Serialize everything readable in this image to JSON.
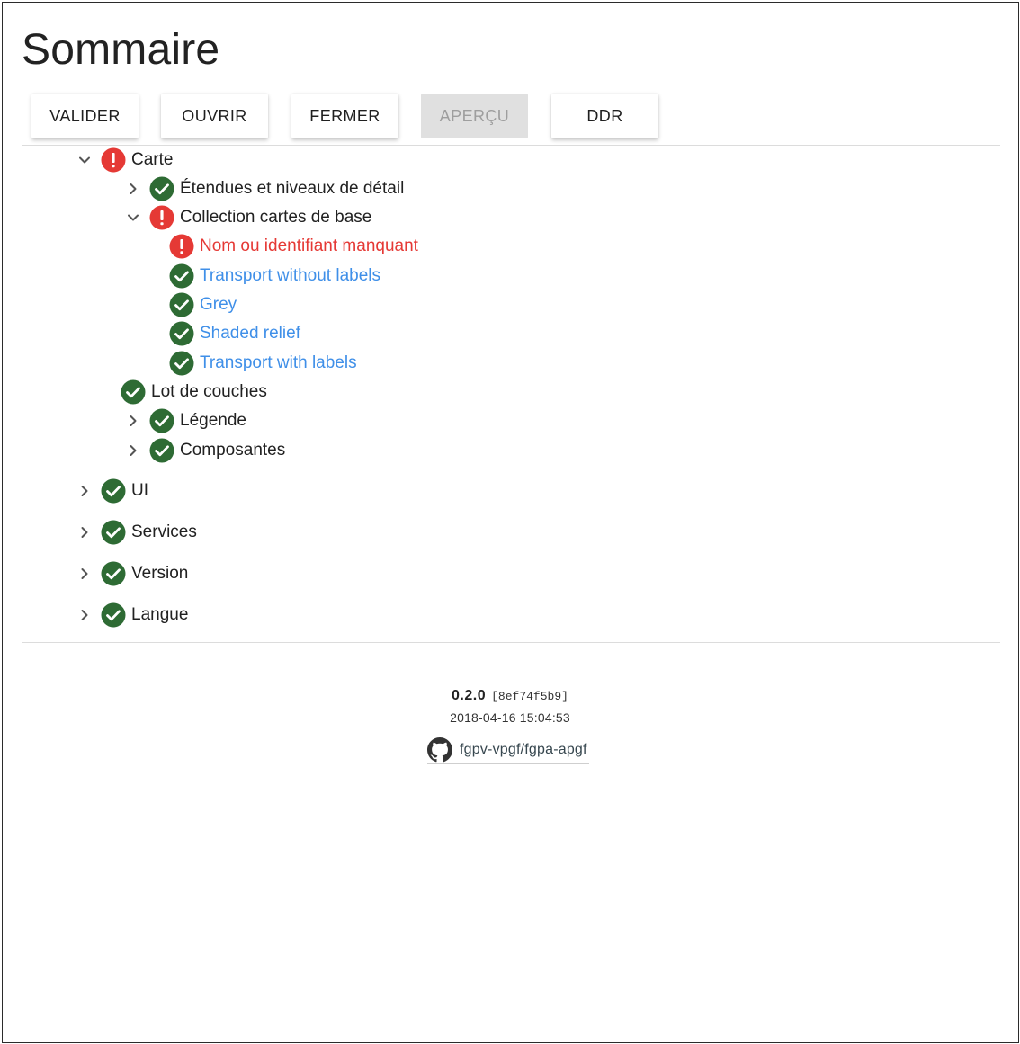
{
  "page": {
    "title": "Sommaire"
  },
  "toolbar": {
    "buttons": [
      {
        "label": "VALIDER",
        "disabled": false
      },
      {
        "label": "OUVRIR",
        "disabled": false
      },
      {
        "label": "FERMER",
        "disabled": false
      },
      {
        "label": "APERÇU",
        "disabled": true
      },
      {
        "label": "DDR",
        "disabled": false
      }
    ]
  },
  "tree": {
    "carte": {
      "label": "Carte",
      "status": "error",
      "expanded": true
    },
    "etendues": {
      "label": "Étendues et niveaux de détail",
      "status": "ok",
      "expanded": false
    },
    "collection": {
      "label": "Collection cartes de base",
      "status": "error",
      "expanded": true
    },
    "nom_manquant": {
      "label": "Nom ou identifiant manquant",
      "status": "error"
    },
    "transport_without": {
      "label": "Transport without labels",
      "status": "ok"
    },
    "grey": {
      "label": "Grey",
      "status": "ok"
    },
    "shaded": {
      "label": "Shaded relief",
      "status": "ok"
    },
    "transport_with": {
      "label": "Transport with labels",
      "status": "ok"
    },
    "lot": {
      "label": "Lot de couches",
      "status": "ok"
    },
    "legende": {
      "label": "Légende",
      "status": "ok",
      "expanded": false
    },
    "composantes": {
      "label": "Composantes",
      "status": "ok",
      "expanded": false
    },
    "ui": {
      "label": "UI",
      "status": "ok",
      "expanded": false
    },
    "services": {
      "label": "Services",
      "status": "ok",
      "expanded": false
    },
    "version": {
      "label": "Version",
      "status": "ok",
      "expanded": false
    },
    "langue": {
      "label": "Langue",
      "status": "ok",
      "expanded": false
    }
  },
  "footer": {
    "version": "0.2.0",
    "hash": "[8ef74f5b9]",
    "date": "2018-04-16 15:04:53",
    "repo": "fgpv-vpgf/fgpa-apgf"
  },
  "colors": {
    "ok": "#2e6b34",
    "error": "#e53935",
    "link": "#3f8fe8"
  },
  "icons": {
    "ok": "check-circle-icon",
    "error": "error-circle-icon",
    "chevron_right": "chevron-right-icon",
    "chevron_down": "chevron-down-icon",
    "repo": "github-icon"
  }
}
